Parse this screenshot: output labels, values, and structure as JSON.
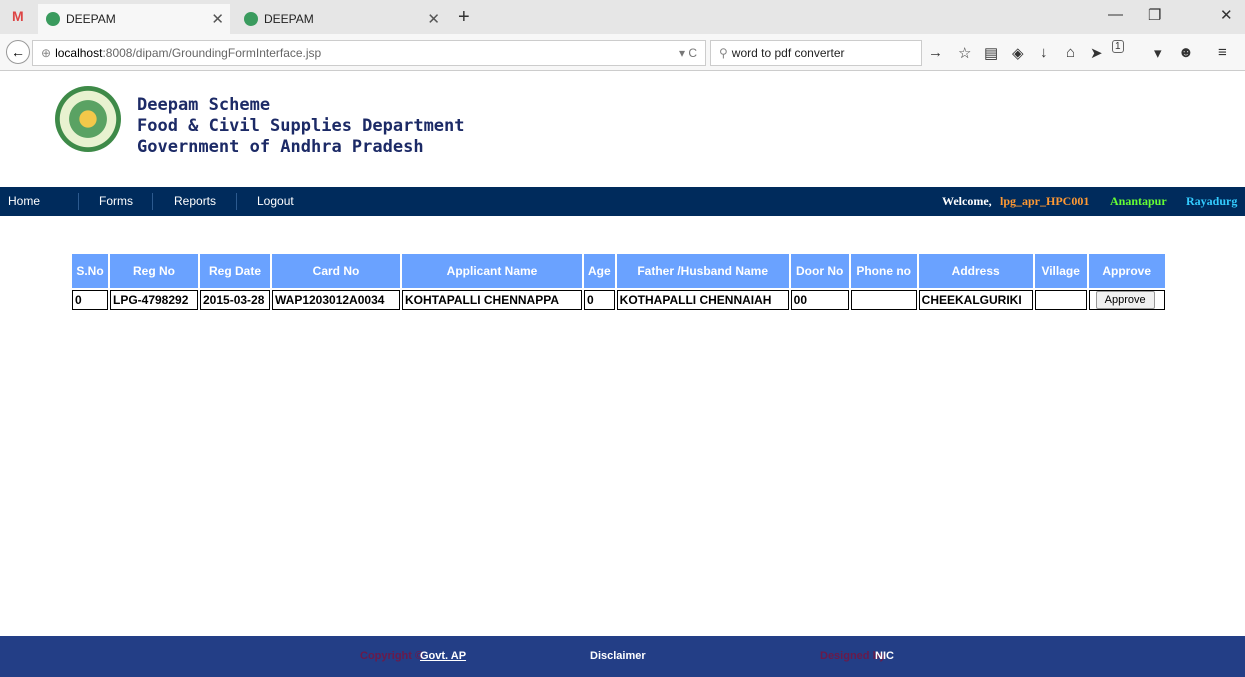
{
  "browser": {
    "tabs": [
      {
        "label": "DEEPAM"
      },
      {
        "label": "DEEPAM"
      }
    ],
    "url_host": "localhost",
    "url_path": ":8008/dipam/GroundingFormInterface.jsp",
    "search_query": "word to pdf converter",
    "notification_count": "1"
  },
  "header": {
    "line1": "Deepam Scheme",
    "line2": "Food & Civil Supplies Department",
    "line3": "Government of Andhra Pradesh"
  },
  "menu": {
    "items": [
      {
        "label": "Home"
      },
      {
        "label": "Forms"
      },
      {
        "label": "Reports"
      },
      {
        "label": "Logout"
      }
    ],
    "welcome_prefix": "Welcome,",
    "user": "lpg_apr_HPC001",
    "district": "Anantapur",
    "mandal": "Rayadurg"
  },
  "table": {
    "headers": [
      "S.No",
      "Reg No",
      "Reg Date",
      "Card No",
      "Applicant Name",
      "Age",
      "Father /Husband Name",
      "Door No",
      "Phone no",
      "Address",
      "Village",
      "Approve"
    ],
    "rows": [
      {
        "sno": "0",
        "reg_no": "LPG-4798292",
        "reg_date": "2015-03-28",
        "card_no": "WAP1203012A0034",
        "applicant_name": "KOHTAPALLI CHENNAPPA",
        "age": "0",
        "father_name": "KOTHAPALLI CHENNAIAH",
        "door_no": "00",
        "phone_no": "",
        "address": "CHEEKALGURIKI",
        "village": "",
        "approve_label": "Approve"
      }
    ]
  },
  "footer": {
    "copyright_prefix": "Copyright ©",
    "copyright_link": "Govt. AP",
    "disclaimer": "Disclaimer",
    "designed_by_prefix": "Designed by",
    "designed_by_link": "NIC"
  },
  "colors": {
    "menubar": "#002b5c",
    "table_header": "#6aa2ff",
    "footer": "#233e86",
    "user": "#ff9933",
    "district": "#66ff33",
    "mandal": "#33ccff"
  }
}
